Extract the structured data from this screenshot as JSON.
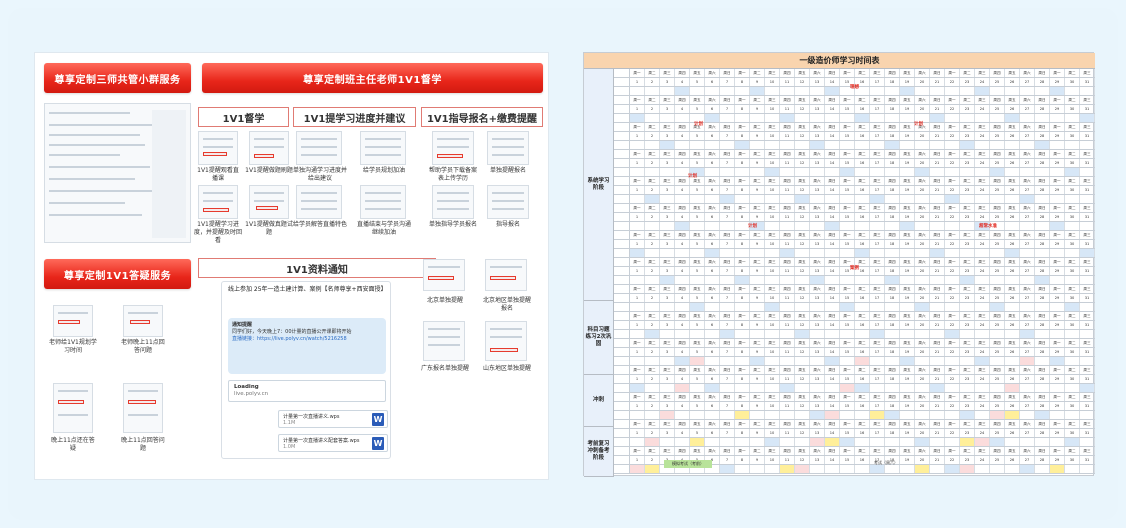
{
  "colors": {
    "banner_red": "#e8261a",
    "frame_bg": "#e9f5fc",
    "header_peach": "#f9d4ae"
  },
  "left": {
    "banner_group": "尊享定制三师共管小群服务",
    "banner_teacher": "尊享定制班主任老师1V1督学",
    "banner_answer": "尊享定制1V1答疑服务",
    "tabs": [
      "1V1督学",
      "1V1提学习进度并建议",
      "1V1指导报名+缴费提醒"
    ],
    "notice_head": "1V1资料通知",
    "captions": {
      "supervise1": "1V1提醒观看直播课",
      "supervise2": "1V1提醒做题刷题",
      "supervise3": "1V1提醒学习进度，并提醒及时回看",
      "supervise4": "1V1提醒做真题试题",
      "progress1": "单独沟通学习进度并给出建议",
      "progress2": "给学员规划加油",
      "progress3": "给学员解答直播特色",
      "progress4": "直播结束与学员沟通继续加油",
      "signup1": "帮助学员下载备案表上传学历",
      "signup2": "单独提醒报名",
      "signup3": "单独指导学员报名",
      "signup4": "指导报名",
      "region1": "北京单独提醒",
      "region2": "北京地区单独提醒报名",
      "region3": "广东报名单独提醒",
      "region4": "山东地区单独提醒",
      "answer1": "老师给1V1规划学习时间",
      "answer2": "老师晚上11点回答问题",
      "answer3": "晚上11点还在答疑",
      "answer4": "晚上11点回答问题"
    },
    "chat": {
      "title": "线上参加  25年一造土建计算、案例【名师尊享+西安面授】",
      "bubble_head": "通知提醒",
      "bubble_text": "同学们好，今天晚上7：00计量的直播公开课即将开始",
      "link_text": "直播链接：https://live.polyv.cn/watch/5216258",
      "loading_title": "Loading",
      "loading_url": "live.polyv.cn",
      "file1": "计量第一次直播讲义.wps",
      "file1_size": "1.1M",
      "file2": "计量第一次直播讲义配套答案.wps",
      "file2_size": "1.0M",
      "word_icon": "W"
    }
  },
  "schedule": {
    "title": "一级造价师学习时间表",
    "stages": [
      "系统学习阶段",
      "科目习题练习2次巩固",
      "冲刺",
      "考前复习冲刺备考阶段"
    ],
    "tags": {
      "plan1": "理想",
      "plan2": "计划",
      "plan3": "计划",
      "plan4": "计划",
      "plan5": "计划",
      "plan6": "超常水准",
      "plan7": "案例"
    },
    "days": [
      "1",
      "2",
      "3",
      "4",
      "5",
      "6",
      "7",
      "8",
      "9",
      "10",
      "11",
      "12",
      "13",
      "14",
      "15",
      "16",
      "17",
      "18",
      "19",
      "20",
      "21",
      "22",
      "23",
      "24",
      "25",
      "26",
      "27",
      "28",
      "29",
      "30",
      "31"
    ],
    "weekdays": [
      "周一",
      "周二",
      "周三",
      "周四",
      "周五",
      "周六",
      "周日"
    ],
    "special": {
      "final_exam": "模拟考试（考前）",
      "exam_day": "考试（周六）"
    }
  }
}
